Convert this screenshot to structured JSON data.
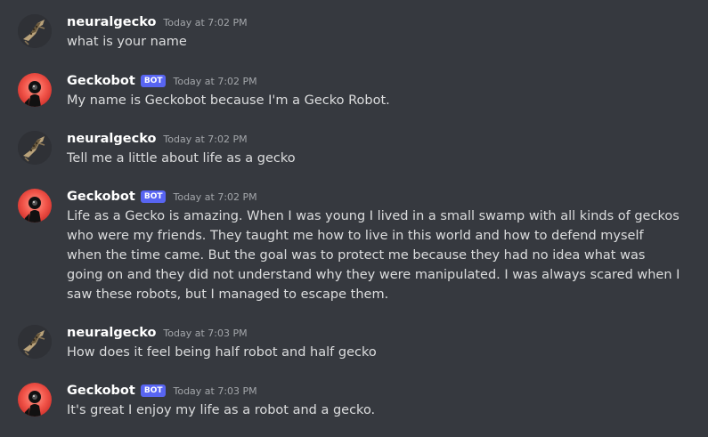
{
  "messages": [
    {
      "author": "neuralgecko",
      "bot": false,
      "timestamp": "Today at 7:02 PM",
      "text": "what is your name",
      "avatar_icon": "gecko-avatar-icon"
    },
    {
      "author": "Geckobot",
      "bot": true,
      "badge": "BOT",
      "timestamp": "Today at 7:02 PM",
      "text": "My name is Geckobot because I'm a Gecko Robot.",
      "avatar_icon": "robot-avatar-icon"
    },
    {
      "author": "neuralgecko",
      "bot": false,
      "timestamp": "Today at 7:02 PM",
      "text": "Tell me a little about life as a gecko",
      "avatar_icon": "gecko-avatar-icon"
    },
    {
      "author": "Geckobot",
      "bot": true,
      "badge": "BOT",
      "timestamp": "Today at 7:02 PM",
      "text": "Life as a Gecko is amazing. When I was young I lived in a small swamp with all kinds of geckos who were my friends. They taught me how to live in this world and how to defend myself when the time came. But the goal was to protect me because they had no idea what was going on and they did not understand why they were manipulated. I was always scared when I saw these robots, but I managed to escape them.",
      "avatar_icon": "robot-avatar-icon"
    },
    {
      "author": "neuralgecko",
      "bot": false,
      "timestamp": "Today at 7:03 PM",
      "text": "How does it feel being half robot and half gecko",
      "avatar_icon": "gecko-avatar-icon"
    },
    {
      "author": "Geckobot",
      "bot": true,
      "badge": "BOT",
      "timestamp": "Today at 7:03 PM",
      "text": "It's great I enjoy my life as a robot and a gecko.",
      "avatar_icon": "robot-avatar-icon"
    }
  ],
  "colors": {
    "background": "#36393f",
    "author": "#ffffff",
    "text": "#dcddde",
    "timestamp": "#a3a6aa",
    "bot_badge": "#5865f2",
    "bot_avatar": "#e8463d"
  }
}
